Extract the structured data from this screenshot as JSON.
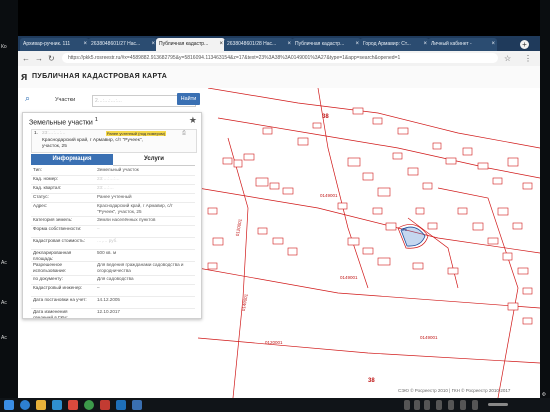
{
  "desktop": {
    "left_icon_labels": [
      "Ко",
      "Ac",
      "Ac",
      "Ac"
    ],
    "right_label": "Ф"
  },
  "browser": {
    "tabs": [
      {
        "label": "Архивар-ручник. 111",
        "active": false
      },
      {
        "label": "2638048601/27 Нас...",
        "active": false
      },
      {
        "label": "Публичная кадастр...",
        "active": true
      },
      {
        "label": "2638048601/28 Нас...",
        "active": false
      },
      {
        "label": "Публичная кадастр...",
        "active": false
      },
      {
        "label": "Город Армавир: Ст...",
        "active": false
      },
      {
        "label": "Личный кабинет -",
        "active": false
      }
    ],
    "url": "https://pkk5.rosreestr.ru/#x=4589882.913682795&y=5816094.113463154&z=17&text=23%3A38%3A0149001%3A27&type=1&app=search&opened=1"
  },
  "pkk": {
    "title": "ПУБЛИЧНАЯ КАДАСТРОВАЯ КАРТА",
    "search_type": "Участки",
    "search_value": "2…:…:…:…",
    "find_label": "Найти"
  },
  "panel": {
    "title": "Земельные участки",
    "count": "1",
    "result": {
      "index": "1.",
      "number": "23:…:…:…",
      "status_badge": "Ранее учтенный (под номером)",
      "address_line1": "Краснодарский край, г Армавир, с/т \"Ручеек\",",
      "address_line2": "участок, 25"
    },
    "tab_info": "Информация",
    "tab_services": "Услуги",
    "rows": [
      {
        "label": "Тип:",
        "value": "Земельный участок"
      },
      {
        "label": "Кад. номер:",
        "value": "23:…:…:…"
      },
      {
        "label": "Кад. квартал:",
        "value": "23:…:…"
      },
      {
        "label": "Статус:",
        "value": "Ранее учтенный"
      },
      {
        "label": "Адрес:",
        "value": "Краснодарский край, г Армавир, с/т \"Ручеек\", участок, 25"
      },
      {
        "label": "Категория земель:",
        "value": "Земли населённых пунктов"
      },
      {
        "label": "Форма собственности:",
        "value": "–"
      },
      {
        "label": "Кадастровая стоимость:",
        "value": "…,… руб."
      },
      {
        "label": "Декларированная площадь:",
        "value": "500 кв. м"
      },
      {
        "label": "Разрешенное использование:",
        "value": "Для ведения гражданами садоводства и огородничества"
      },
      {
        "label": "по документу:",
        "value": "Для садоводства"
      },
      {
        "label": "Кадастровый инженер:",
        "value": "–"
      },
      {
        "label": "Дата постановки на учет:",
        "value": "14.12.2005"
      },
      {
        "label": "Дата изменения сведений в ГКН:",
        "value": "12.10.2017"
      },
      {
        "label": "Дата выгрузки сведений из ГКН:",
        "value": "31.12.2017"
      }
    ]
  },
  "map": {
    "labels": [
      "38",
      "0149001",
      "0149001",
      "0149001",
      "0120001",
      "0120001",
      "0149001",
      "38",
      "25"
    ],
    "copyright": "СЭЮ © Росреестр 2010 | ГКН © Росреестр 2010-2017"
  },
  "colors": {
    "accent": "#3a70b3",
    "parcel_line": "#d01818"
  }
}
